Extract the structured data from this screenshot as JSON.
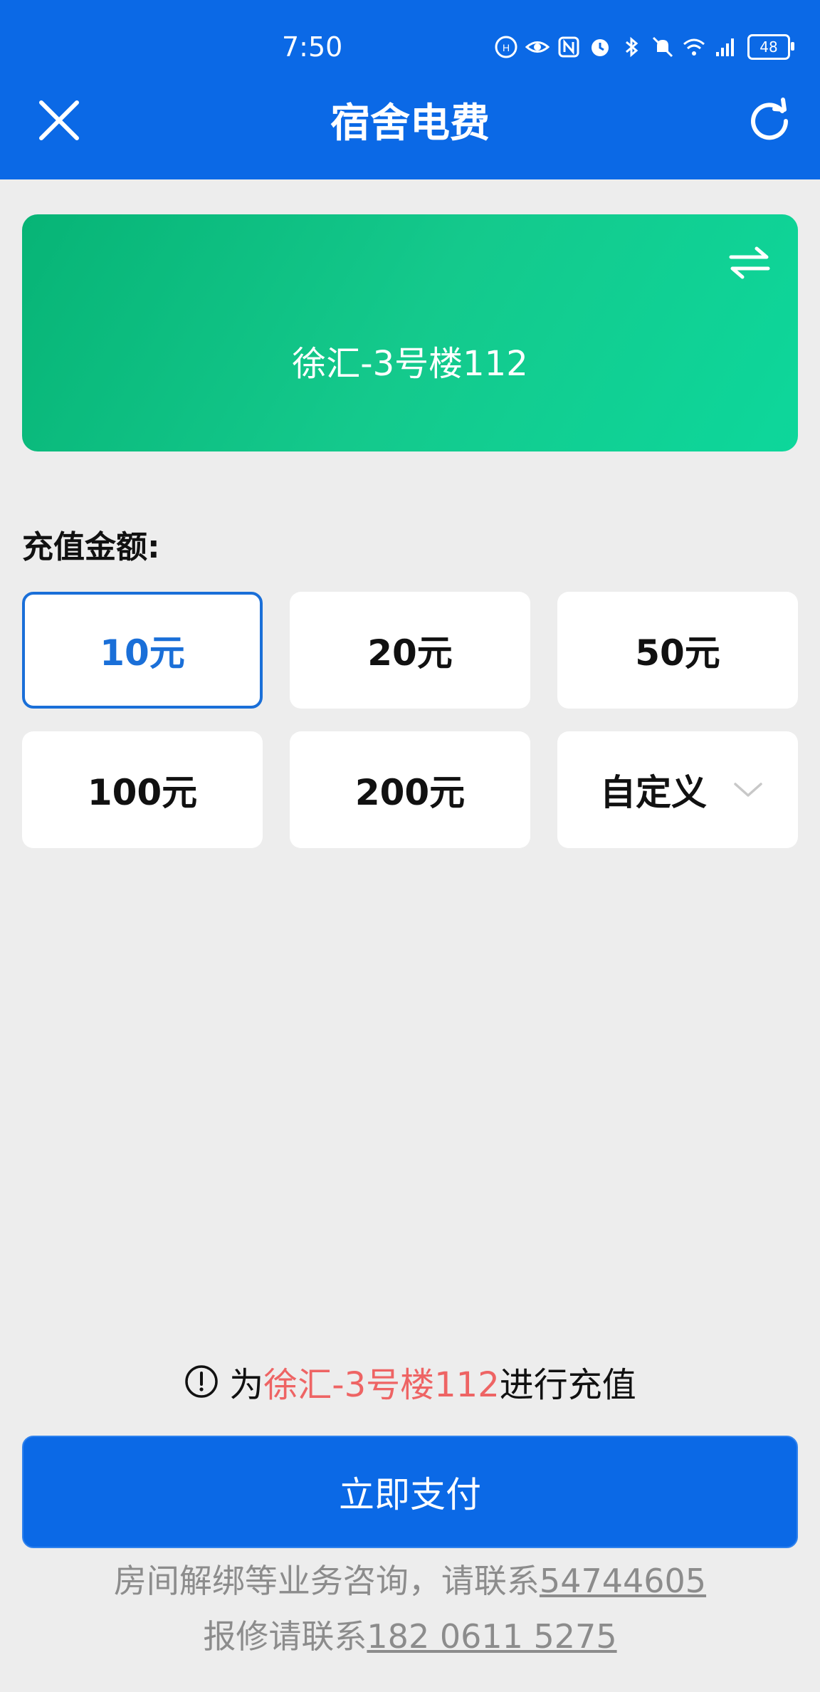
{
  "status_bar": {
    "time": "7:50",
    "battery": "48",
    "icons": [
      "hd-call-icon",
      "eye-icon",
      "nfc-icon",
      "alarm-icon",
      "bluetooth-icon",
      "mute-bell-icon",
      "wifi-icon",
      "5g-signal-icon",
      "battery-icon"
    ]
  },
  "header": {
    "title": "宿舍电费",
    "close_icon": "close-icon",
    "refresh_icon": "refresh-icon",
    "background_color": "#0b69e6"
  },
  "room_card": {
    "room": "徐汇-3号楼112",
    "switch_icon": "swap-arrows-icon",
    "gradient_colors": [
      "#07b476",
      "#0dd79b"
    ]
  },
  "amount": {
    "label": "充值金额:",
    "options": [
      {
        "label": "10元",
        "selected": true
      },
      {
        "label": "20元",
        "selected": false
      },
      {
        "label": "50元",
        "selected": false
      },
      {
        "label": "100元",
        "selected": false
      },
      {
        "label": "200元",
        "selected": false
      },
      {
        "label": "自定义",
        "selected": false,
        "dropdown": true
      }
    ],
    "selected_color": "#1a6fd8"
  },
  "notice": {
    "prefix": "为",
    "room": "徐汇-3号楼112",
    "suffix": "进行充值",
    "highlight_color": "#ee6464",
    "icon": "info-icon"
  },
  "pay_button": {
    "label": "立即支付"
  },
  "footer": {
    "line1_text": "房间解绑等业务咨询，请联系",
    "line1_phone": "54744605",
    "line2_text": "报修请联系",
    "line2_phone": "182 0611 5275"
  }
}
